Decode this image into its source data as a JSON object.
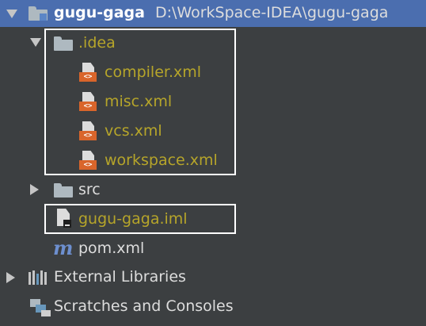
{
  "tree": {
    "project": {
      "name": "gugu-gaga",
      "path": "D:\\WorkSpace-IDEA\\gugu-gaga"
    },
    "idea_folder": {
      "label": ".idea"
    },
    "idea_files": [
      {
        "label": "compiler.xml"
      },
      {
        "label": "misc.xml"
      },
      {
        "label": "vcs.xml"
      },
      {
        "label": "workspace.xml"
      }
    ],
    "src_folder": {
      "label": "src"
    },
    "iml_file": {
      "label": "gugu-gaga.iml"
    },
    "pom_file": {
      "label": "pom.xml",
      "icon_glyph": "m"
    },
    "external_libraries": {
      "label": "External Libraries"
    },
    "scratches": {
      "label": "Scratches and Consoles"
    }
  },
  "colors": {
    "background": "#3c3f41",
    "selection": "#4b6eaf",
    "vcs_unversioned": "#b6a52a",
    "highlight_box": "#ffffff"
  }
}
